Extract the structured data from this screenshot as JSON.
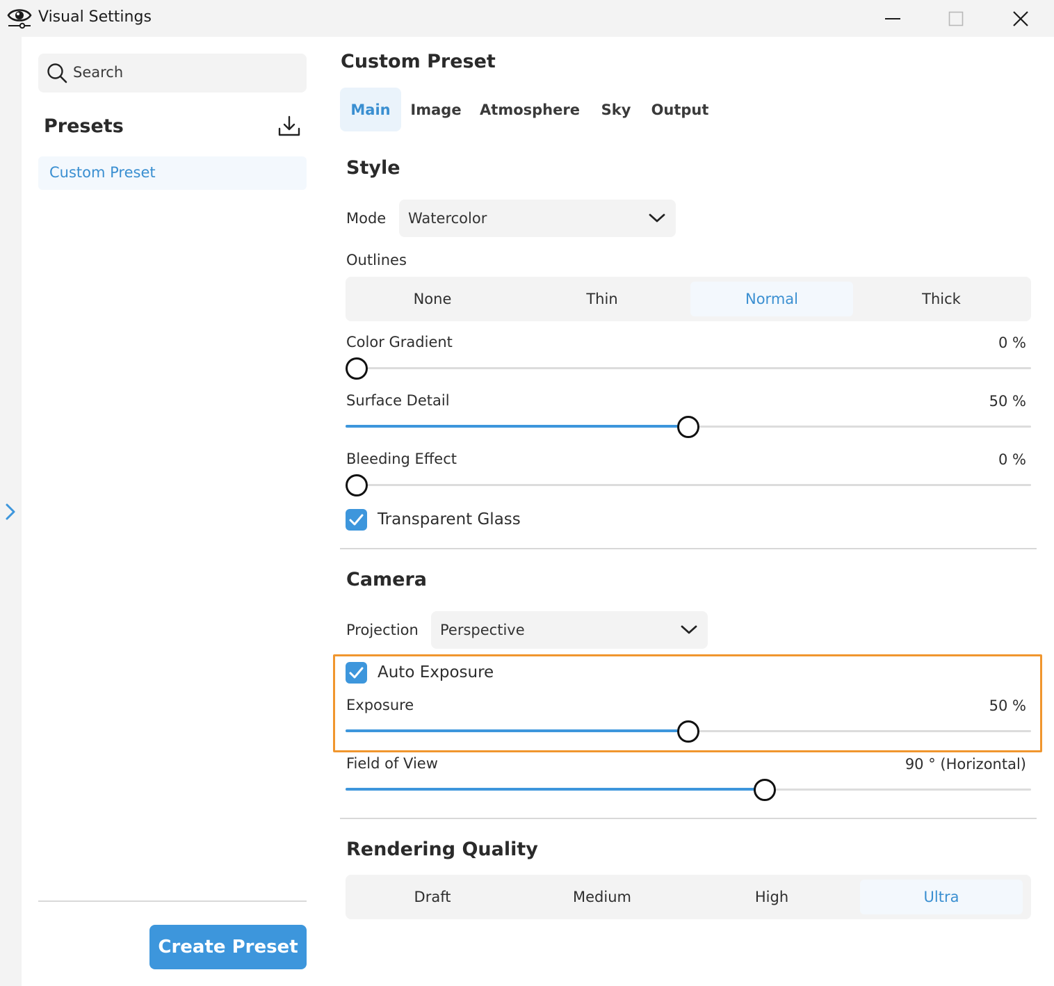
{
  "window": {
    "title": "Visual Settings",
    "icons": {
      "app": "eye-settings-icon",
      "minimize": "minimize-icon",
      "maximize": "maximize-icon",
      "close": "close-icon",
      "expand": "chevron-right-icon"
    }
  },
  "sidebar": {
    "search_placeholder": "Search",
    "presets_title": "Presets",
    "import_icon": "download-icon",
    "presets": [
      {
        "label": "Custom Preset",
        "selected": true
      }
    ],
    "create_button": "Create Preset"
  },
  "main": {
    "title": "Custom Preset",
    "tabs": [
      {
        "label": "Main",
        "active": true
      },
      {
        "label": "Image",
        "active": false
      },
      {
        "label": "Atmosphere",
        "active": false
      },
      {
        "label": "Sky",
        "active": false
      },
      {
        "label": "Output",
        "active": false
      }
    ],
    "style": {
      "title": "Style",
      "mode_label": "Mode",
      "mode_value": "Watercolor",
      "outlines_label": "Outlines",
      "outlines_options": [
        "None",
        "Thin",
        "Normal",
        "Thick"
      ],
      "outlines_selected": "Normal",
      "color_gradient": {
        "label": "Color Gradient",
        "value": 0,
        "display": "0  %"
      },
      "surface_detail": {
        "label": "Surface Detail",
        "value": 50,
        "display": "50  %"
      },
      "bleeding_effect": {
        "label": "Bleeding Effect",
        "value": 0,
        "display": "0  %"
      },
      "transparent_glass": {
        "label": "Transparent Glass",
        "checked": true
      }
    },
    "camera": {
      "title": "Camera",
      "projection_label": "Projection",
      "projection_value": "Perspective",
      "auto_exposure": {
        "label": "Auto Exposure",
        "checked": true
      },
      "exposure": {
        "label": "Exposure",
        "value": 50,
        "display": "50  %"
      },
      "fov": {
        "label": "Field of View",
        "value": 90,
        "fraction": 0.612,
        "display": "90  ° (Horizontal)"
      }
    },
    "quality": {
      "title": "Rendering Quality",
      "options": [
        "Draft",
        "Medium",
        "High",
        "Ultra"
      ],
      "selected": "Ultra"
    }
  },
  "colors": {
    "accent": "#3d96dc",
    "highlight": "#f0962e",
    "selected_bg": "#f3f8fd"
  }
}
